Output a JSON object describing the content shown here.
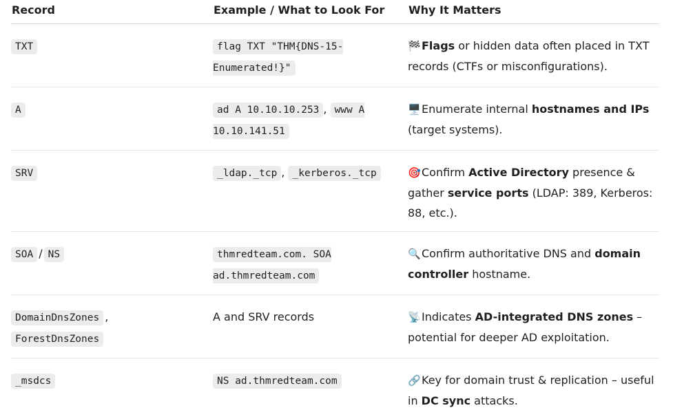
{
  "header": {
    "col1": "Record",
    "col2": "Example / What to Look For",
    "col3": "Why It Matters"
  },
  "rows": [
    {
      "record": [
        "TXT"
      ],
      "example_codes": [
        "flag TXT \"THM{DNS-15-Enumerated!}\""
      ],
      "emoji": "🏁",
      "why": [
        {
          "text": "Flags",
          "bold": true
        },
        {
          "text": " or hidden data often placed in TXT records (CTFs or misconfigurations).",
          "bold": false
        }
      ]
    },
    {
      "record": [
        "A"
      ],
      "example_codes": [
        "ad A 10.10.10.253",
        "www A 10.10.141.51"
      ],
      "emoji": "🖥️",
      "why": [
        {
          "text": "Enumerate internal ",
          "bold": false
        },
        {
          "text": "hostnames and IPs",
          "bold": true
        },
        {
          "text": " (target systems).",
          "bold": false
        }
      ]
    },
    {
      "record": [
        "SRV"
      ],
      "example_codes": [
        "_ldap._tcp",
        "_kerberos._tcp"
      ],
      "emoji": "🎯",
      "why": [
        {
          "text": "Confirm ",
          "bold": false
        },
        {
          "text": "Active Directory",
          "bold": true
        },
        {
          "text": " presence & gather ",
          "bold": false
        },
        {
          "text": "service ports",
          "bold": true
        },
        {
          "text": " (LDAP: 389, Kerberos: 88, etc.).",
          "bold": false
        }
      ]
    },
    {
      "record": [
        "SOA",
        "NS"
      ],
      "record_sep": "/",
      "example_codes": [
        "thmredteam.com. SOA ad.thmredteam.com"
      ],
      "emoji": "🔍",
      "why": [
        {
          "text": "Confirm authoritative DNS and ",
          "bold": false
        },
        {
          "text": "domain controller",
          "bold": true
        },
        {
          "text": " hostname.",
          "bold": false
        }
      ]
    },
    {
      "record": [
        "DomainDnsZones",
        "ForestDnsZones"
      ],
      "record_sep": ",",
      "example_text": "A and SRV records",
      "emoji": "📡",
      "why": [
        {
          "text": "Indicates ",
          "bold": false
        },
        {
          "text": "AD-integrated DNS zones",
          "bold": true
        },
        {
          "text": " – potential for deeper AD exploitation.",
          "bold": false
        }
      ]
    },
    {
      "record": [
        "_msdcs"
      ],
      "example_codes": [
        "NS ad.thmredteam.com"
      ],
      "emoji": "🔗",
      "why": [
        {
          "text": "Key for domain trust & replication – useful in ",
          "bold": false
        },
        {
          "text": "DC sync",
          "bold": true
        },
        {
          "text": " attacks.",
          "bold": false
        }
      ]
    }
  ]
}
